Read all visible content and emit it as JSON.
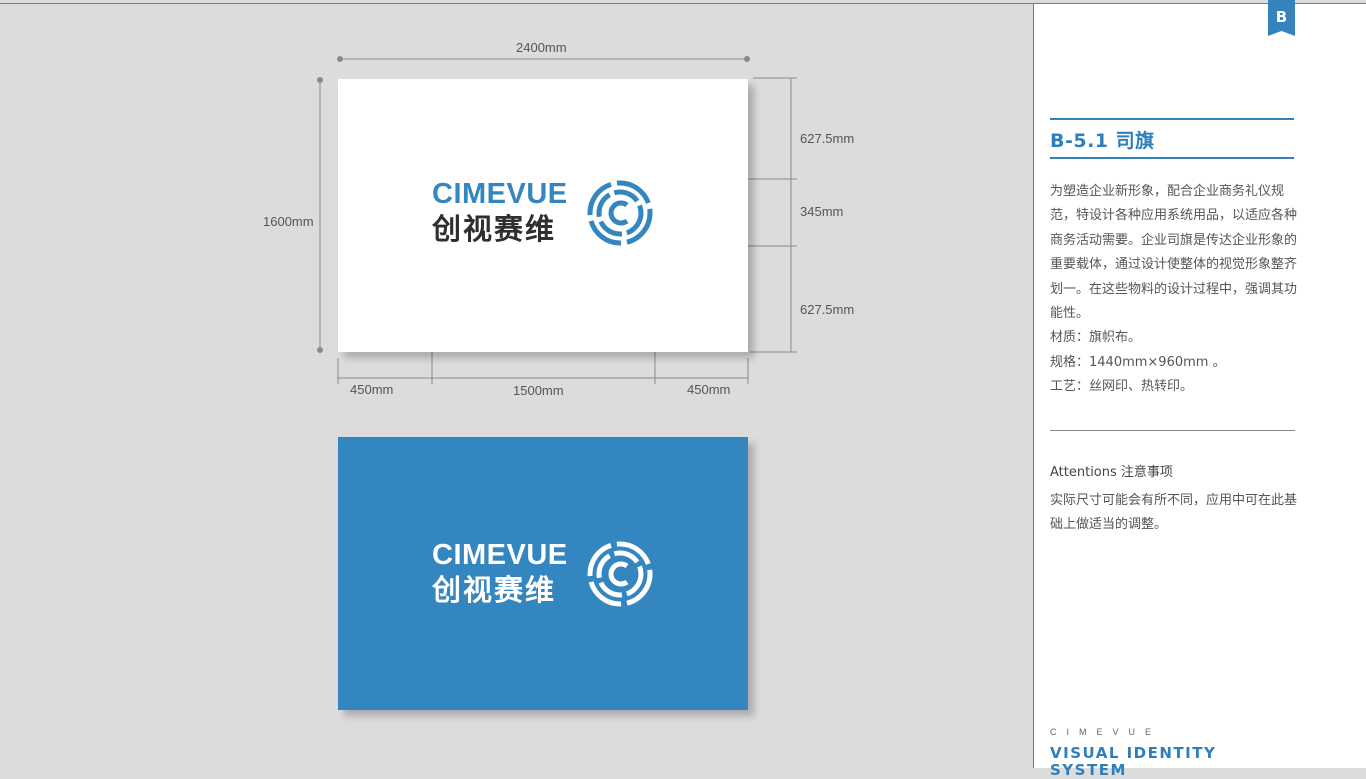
{
  "tab_marker": "B",
  "section": {
    "title": "B-5.1  司旗",
    "description": [
      "为塑造企业新形象，配合企业商务礼仪规范，特设计各种应用系统用品，以适应各种商务活动需要。企业司旗是传达企业形象的重要载体，通过设计使整体的视觉形象整齐划一。在这些物料的设计过程中，强调其功能性。",
      "材质：旗帜布。",
      "规格：1440mm×960mm 。",
      "工艺：丝网印、热转印。"
    ],
    "attentions_title": "Attentions  注意事项",
    "attentions_text": "实际尺寸可能会有所不同，应用中可在此基础上做适当的调整。"
  },
  "footer": {
    "brand_spaced": "CIMEVUE",
    "line1": "VISUAL IDENTITY",
    "line2": "SYSTEM"
  },
  "logo": {
    "wordmark": "CIMEVUE",
    "chinese_name": "创视赛维"
  },
  "dimensions": {
    "total_width": "2400mm",
    "total_height": "1600mm",
    "top_margin": "627.5mm",
    "logo_height": "345mm",
    "bottom_margin": "627.5mm",
    "left_margin": "450mm",
    "logo_width": "1500mm",
    "right_margin": "450mm"
  },
  "colors": {
    "brand_blue": "#3386bf",
    "dark_text": "#2f2f2f",
    "white": "#ffffff"
  }
}
